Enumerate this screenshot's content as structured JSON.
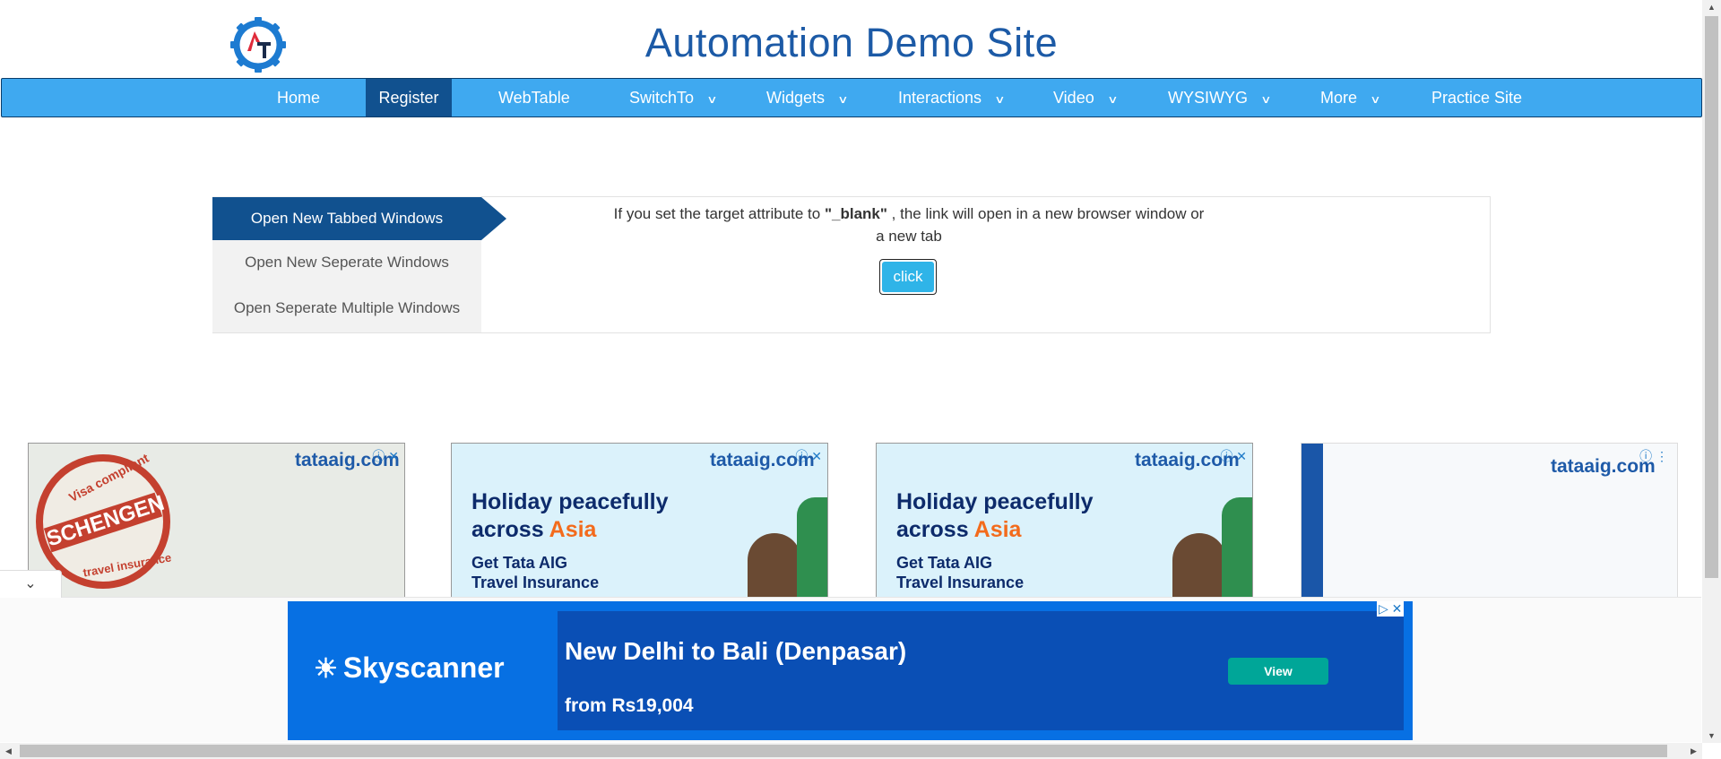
{
  "header": {
    "title": "Automation Demo Site",
    "logo_letters": "AT"
  },
  "nav": {
    "items": [
      {
        "label": "Home"
      },
      {
        "label": "Register"
      },
      {
        "label": "WebTable"
      },
      {
        "label": "SwitchTo"
      },
      {
        "label": "Widgets"
      },
      {
        "label": "Interactions"
      },
      {
        "label": "Video"
      },
      {
        "label": "WYSIWYG"
      },
      {
        "label": "More"
      },
      {
        "label": "Practice Site"
      }
    ],
    "active": "Register",
    "chevron": "⌄"
  },
  "tabs": {
    "active_label": "Open New Tabbed Windows",
    "items": [
      {
        "label": "Open New Seperate Windows"
      },
      {
        "label": "Open Seperate Multiple Windows"
      }
    ]
  },
  "content": {
    "desc_before": "If you set the target attribute to ",
    "desc_bold": "\"_blank\"",
    "desc_after": " , the link will open in a new browser window or a new tab",
    "button_label": "click"
  },
  "ads": {
    "brand": "tataaig.com",
    "ad1": {
      "stamp_top": "Visa compliant",
      "stamp_main": "SCHENGEN",
      "stamp_bottom": "travel insurance"
    },
    "ad2": {
      "line1": "Holiday peacefully",
      "line2a": "across ",
      "line2b": "Asia",
      "sub1": "Get Tata AIG",
      "sub2": "Travel Insurance"
    },
    "ad3": {
      "line1": "Holiday peacefully",
      "line2a": "across ",
      "line2b": "Asia",
      "sub1": "Get Tata AIG",
      "sub2": "Travel Insurance"
    },
    "ad_controls": "ⓘ ✕"
  },
  "bottom_ad": {
    "brand": "Skyscanner",
    "title": "New Delhi to Bali (Denpasar)",
    "price": "from Rs19,004",
    "view_label": "View",
    "controls": "▷ ✕",
    "collapse_icon": "⌄"
  },
  "colors": {
    "nav_bg": "#3fa9f0",
    "nav_active": "#11518f",
    "title": "#1c5aa6",
    "button": "#2fb4e8",
    "skyscanner": "#0770e3"
  }
}
